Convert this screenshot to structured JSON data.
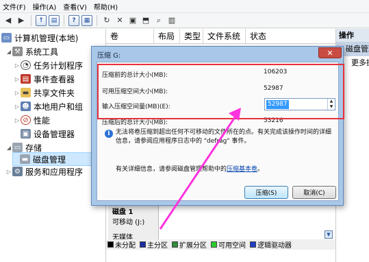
{
  "menu": [
    "文件(F)",
    "操作(A)",
    "查看(V)",
    "帮助(H)"
  ],
  "tree": {
    "items": [
      {
        "label": "计算机管理(本地)",
        "level": 0,
        "arrow": "",
        "icon": "computer-icon"
      },
      {
        "label": "系统工具",
        "level": 1,
        "arrow": "◢",
        "icon": "tools-icon"
      },
      {
        "label": "任务计划程序",
        "level": 2,
        "arrow": "▷",
        "icon": "clock-icon"
      },
      {
        "label": "事件查看器",
        "level": 2,
        "arrow": "▷",
        "icon": "event-viewer-icon"
      },
      {
        "label": "共享文件夹",
        "level": 2,
        "arrow": "▷",
        "icon": "shared-folder-icon"
      },
      {
        "label": "本地用户和组",
        "level": 2,
        "arrow": "▷",
        "icon": "users-icon"
      },
      {
        "label": "性能",
        "level": 2,
        "arrow": "▷",
        "icon": "performance-icon"
      },
      {
        "label": "设备管理器",
        "level": 2,
        "arrow": "",
        "icon": "device-manager-icon"
      },
      {
        "label": "存储",
        "level": 1,
        "arrow": "◢",
        "icon": "storage-icon"
      },
      {
        "label": "磁盘管理",
        "level": 2,
        "arrow": "",
        "icon": "disk-icon",
        "selected": true
      },
      {
        "label": "服务和应用程序",
        "level": 1,
        "arrow": "▷",
        "icon": "services-icon"
      }
    ]
  },
  "columns": [
    "卷",
    "布局",
    "类型",
    "文件系统",
    "状态"
  ],
  "actions": {
    "header": "操作",
    "sub": "磁盘管理",
    "more": "更多操作"
  },
  "disk": {
    "name": "磁盘 1",
    "type": "可移动 (J:)",
    "media": "无媒体"
  },
  "legend": [
    {
      "label": "未分配",
      "color": "#000000"
    },
    {
      "label": "主分区",
      "color": "#1b2ea3"
    },
    {
      "label": "扩展分区",
      "color": "#2e8b3a"
    },
    {
      "label": "可用空间",
      "color": "#2ccc2c"
    },
    {
      "label": "逻辑驱动器",
      "color": "#1f3fc6"
    }
  ],
  "dialog": {
    "title": "压缩 G:",
    "close": "✕",
    "rows": [
      {
        "label": "压缩前的总计大小(MB):",
        "value": "106203"
      },
      {
        "label": "可用压缩空间大小(MB):",
        "value": "52987"
      },
      {
        "label": "输入压缩空间量(MB)(E):",
        "value": "52987"
      },
      {
        "label": "压缩后的总计大小(MB):",
        "value": "53216"
      }
    ],
    "info": "无法将卷压缩到超出任何不可移动的文件所在的点。有关完成该操作时间的详细信息，请参阅应用程序日志中的 \"defrag\" 事件。",
    "more_info_prefix": "有关详细信息，请参阅磁盘管理帮助中的",
    "more_info_link": "压缩基本卷",
    "more_info_suffix": "。",
    "ok_label": "压缩(S)",
    "cancel_label": "取消(C)"
  },
  "colors": {
    "highlight": "#e8303a",
    "arrow": "#ff33dd",
    "dialog_frame": "#a9c7e8"
  }
}
